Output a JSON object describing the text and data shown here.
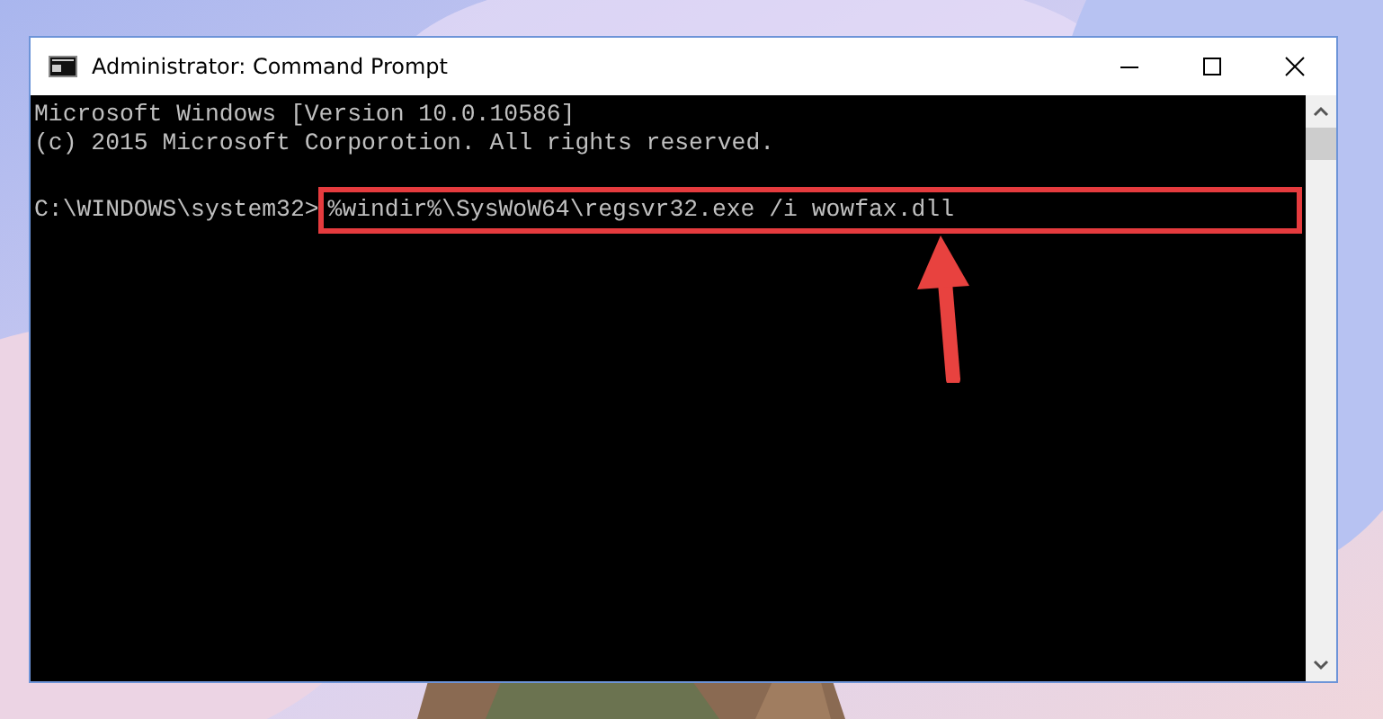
{
  "window": {
    "title": "Administrator: Command Prompt"
  },
  "console": {
    "lines": [
      "Microsoft Windows [Version 10.0.10586]",
      "(c) 2015 Microsoft Corporotion. All rights reserved."
    ],
    "prompt": "C:\\WINDOWS\\system32>",
    "command": "%windir%\\SysWoW64\\regsvr32.exe /i wowfax.dll"
  }
}
